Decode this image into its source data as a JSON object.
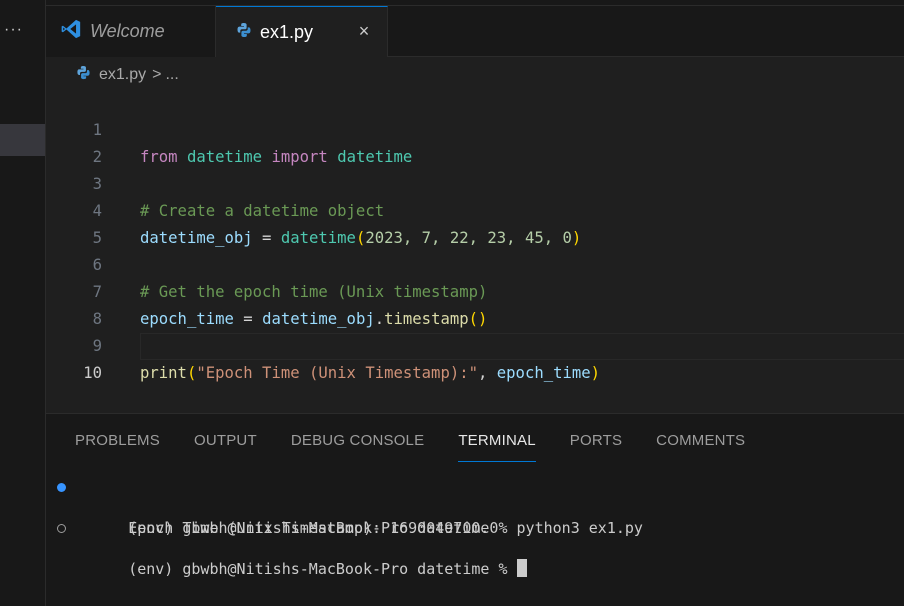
{
  "sidebar": {
    "more_label": "···"
  },
  "tabs": [
    {
      "label": "Welcome",
      "icon": "vscode-icon"
    },
    {
      "label": "ex1.py",
      "icon": "python-file-icon",
      "close_glyph": "×"
    }
  ],
  "breadcrumb": {
    "file": "ex1.py",
    "separator": ">",
    "rest": "..."
  },
  "editor": {
    "lines": [
      "1",
      "2",
      "3",
      "4",
      "5",
      "6",
      "7",
      "8",
      "9",
      "10"
    ],
    "active_line": "10",
    "code": {
      "l1": {
        "from": "from",
        "mod1": "datetime",
        "import": "import",
        "mod2": "datetime"
      },
      "l3": {
        "comment": "# Create a datetime object"
      },
      "l4": {
        "var": "datetime_obj",
        "eq": " = ",
        "fn": "datetime",
        "open": "(",
        "args": "2023, 7, 22, 23, 45, 0",
        "close": ")"
      },
      "l6": {
        "comment": "# Get the epoch time (Unix timestamp)"
      },
      "l7": {
        "var": "epoch_time",
        "eq": " = ",
        "obj": "datetime_obj",
        "dot": ".",
        "method": "timestamp",
        "parens": "()"
      },
      "l9": {
        "fn": "print",
        "open": "(",
        "str": "\"Epoch Time (Unix Timestamp):\"",
        "comma": ", ",
        "arg": "epoch_time",
        "close": ")"
      }
    }
  },
  "panel": {
    "tabs": [
      "PROBLEMS",
      "OUTPUT",
      "DEBUG CONSOLE",
      "TERMINAL",
      "PORTS",
      "COMMENTS"
    ],
    "active_tab": "TERMINAL",
    "terminal": {
      "line1": "(env) gbwbh@Nitishs-MacBook-Pro datetime % python3 ex1.py",
      "line2": "Epoch Time (Unix Timestamp): 1690049700.0",
      "line3": "(env) gbwbh@Nitishs-MacBook-Pro datetime % "
    }
  },
  "colors": {
    "accent": "#0078d4",
    "keyword": "#c586c0",
    "module": "#4ec9b0",
    "comment": "#6a9955",
    "variable": "#9cdcfe",
    "function": "#dcdcaa",
    "number": "#b5cea8",
    "string": "#ce9178"
  }
}
